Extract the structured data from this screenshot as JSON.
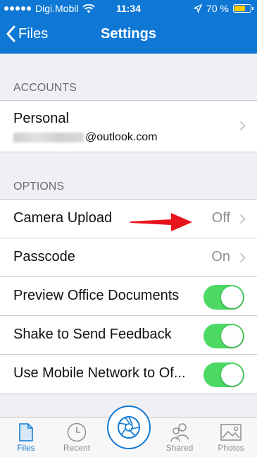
{
  "status_bar": {
    "carrier": "Digi.Mobil",
    "time": "11:34",
    "battery": "70 %",
    "battery_level": 0.7
  },
  "nav": {
    "back_label": "Files",
    "title": "Settings"
  },
  "accounts": {
    "header": "ACCOUNTS",
    "personal": {
      "name": "Personal",
      "email_suffix": "@outlook.com"
    }
  },
  "options": {
    "header": "OPTIONS",
    "camera_upload": {
      "label": "Camera Upload",
      "value": "Off"
    },
    "passcode": {
      "label": "Passcode",
      "value": "On"
    },
    "preview_office": {
      "label": "Preview Office Documents",
      "on": true
    },
    "shake_feedback": {
      "label": "Shake to Send Feedback",
      "on": true
    },
    "mobile_network": {
      "label": "Use Mobile Network to Of...",
      "on": true
    }
  },
  "tabs": {
    "files": "Files",
    "recent": "Recent",
    "shared": "Shared",
    "photos": "Photos"
  },
  "colors": {
    "accent": "#0f78d4",
    "toggle_on": "#4cd964",
    "arrow": "#e8141c"
  }
}
